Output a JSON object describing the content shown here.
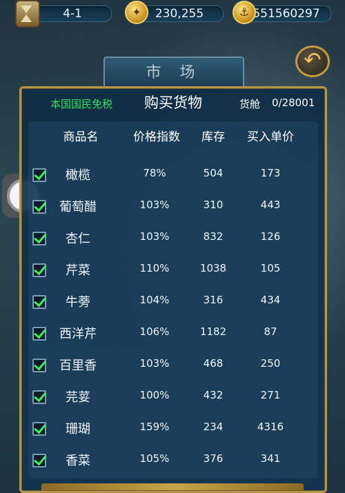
{
  "topbar": {
    "level": "4-1",
    "gold": "230,255",
    "ducats": "551560297"
  },
  "market": {
    "title": "市 场"
  },
  "panel": {
    "tax_note": "本国国民免税",
    "title": "购买货物",
    "cargo_label": "货舱",
    "cargo_value": "0/28001"
  },
  "table": {
    "headers": [
      "商品名",
      "价格指数",
      "库存",
      "买入单价"
    ],
    "rows": [
      {
        "name": "橄榄",
        "index": "78%",
        "stock": "504",
        "price": "173",
        "checked": true
      },
      {
        "name": "葡萄醋",
        "index": "103%",
        "stock": "310",
        "price": "443",
        "checked": true
      },
      {
        "name": "杏仁",
        "index": "103%",
        "stock": "832",
        "price": "126",
        "checked": true
      },
      {
        "name": "芹菜",
        "index": "110%",
        "stock": "1038",
        "price": "105",
        "checked": true
      },
      {
        "name": "牛蒡",
        "index": "104%",
        "stock": "316",
        "price": "434",
        "checked": true
      },
      {
        "name": "西洋芹",
        "index": "106%",
        "stock": "1182",
        "price": "87",
        "checked": true
      },
      {
        "name": "百里香",
        "index": "103%",
        "stock": "468",
        "price": "250",
        "checked": true
      },
      {
        "name": "芫荽",
        "index": "100%",
        "stock": "432",
        "price": "271",
        "checked": true
      },
      {
        "name": "珊瑚",
        "index": "159%",
        "stock": "234",
        "price": "4316",
        "checked": true
      },
      {
        "name": "香菜",
        "index": "105%",
        "stock": "376",
        "price": "341",
        "checked": true
      }
    ]
  },
  "icons": {
    "hourglass": "hourglass-icon",
    "gold_coin": "gold-coin-icon",
    "ducat_coin": "anchor-coin-icon",
    "back": "back-arrow-icon"
  }
}
